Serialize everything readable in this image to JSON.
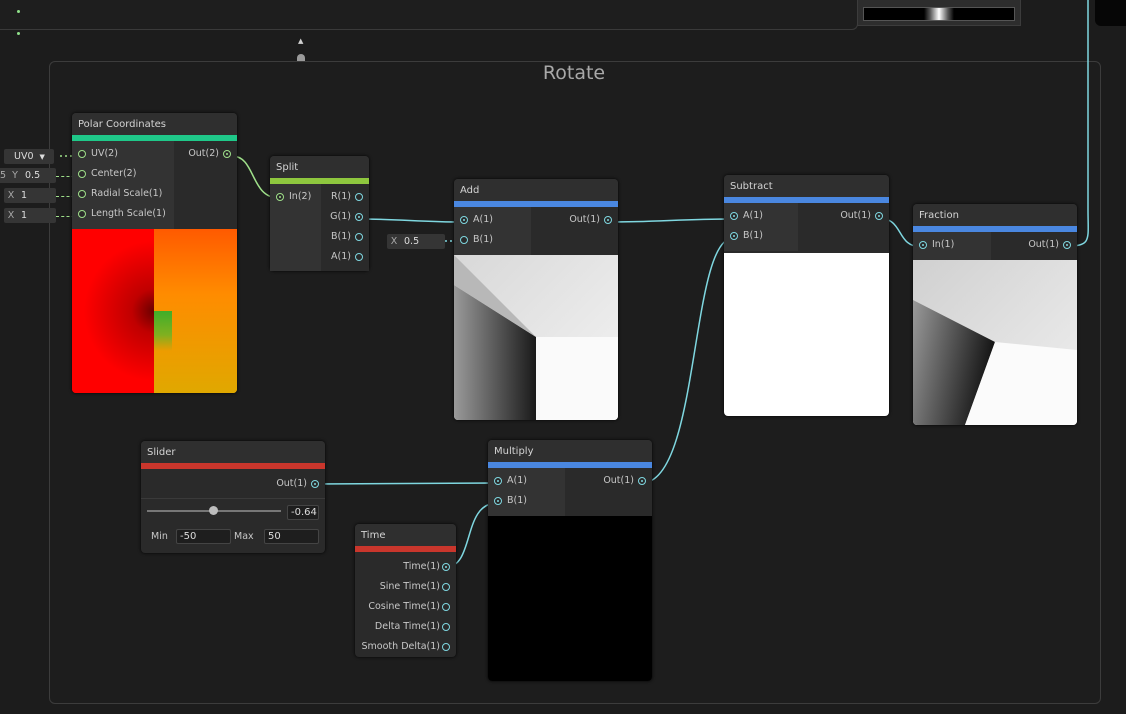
{
  "group": {
    "title": "Rotate"
  },
  "nodes": {
    "polar": {
      "title": "Polar Coordinates",
      "inputs": [
        "UV(2)",
        "Center(2)",
        "Radial Scale(1)",
        "Length Scale(1)"
      ],
      "output": "Out(2)",
      "defaults": {
        "uv": "UV0",
        "center_y_label": "Y",
        "center_y_value": "0.5",
        "radial_x_label": "X",
        "radial_x_value": "1",
        "length_x_label": "X",
        "length_x_value": "1"
      }
    },
    "split": {
      "title": "Split",
      "input": "In(2)",
      "outputs": [
        "R(1)",
        "G(1)",
        "B(1)",
        "A(1)"
      ]
    },
    "add": {
      "title": "Add",
      "inputs": [
        "A(1)",
        "B(1)"
      ],
      "output": "Out(1)",
      "b_default_label": "X",
      "b_default_value": "0.5"
    },
    "subtract": {
      "title": "Subtract",
      "inputs": [
        "A(1)",
        "B(1)"
      ],
      "output": "Out(1)"
    },
    "fraction": {
      "title": "Fraction",
      "input": "In(1)",
      "output": "Out(1)"
    },
    "slider": {
      "title": "Slider",
      "output": "Out(1)",
      "value": "-0.64",
      "min_label": "Min",
      "min": "-50",
      "max_label": "Max",
      "max": "50",
      "knob_fraction": 0.49
    },
    "multiply": {
      "title": "Multiply",
      "inputs": [
        "A(1)",
        "B(1)"
      ],
      "output": "Out(1)"
    },
    "time": {
      "title": "Time",
      "outputs": [
        "Time(1)",
        "Sine Time(1)",
        "Cosine Time(1)",
        "Delta Time(1)",
        "Smooth Delta(1)"
      ]
    }
  },
  "colors": {
    "wire": "#7fd7e0",
    "wire_vec2": "#9fe08a",
    "polar_accent": "#1fc889",
    "split_accent": "#8ec73e",
    "math_accent": "#4a87e0",
    "property_accent": "#c9362c"
  },
  "icons": {
    "dropdown": "chevron-down-icon",
    "scroll_up": "arrow-up-icon",
    "scroll_down": "arrow-down-icon"
  }
}
